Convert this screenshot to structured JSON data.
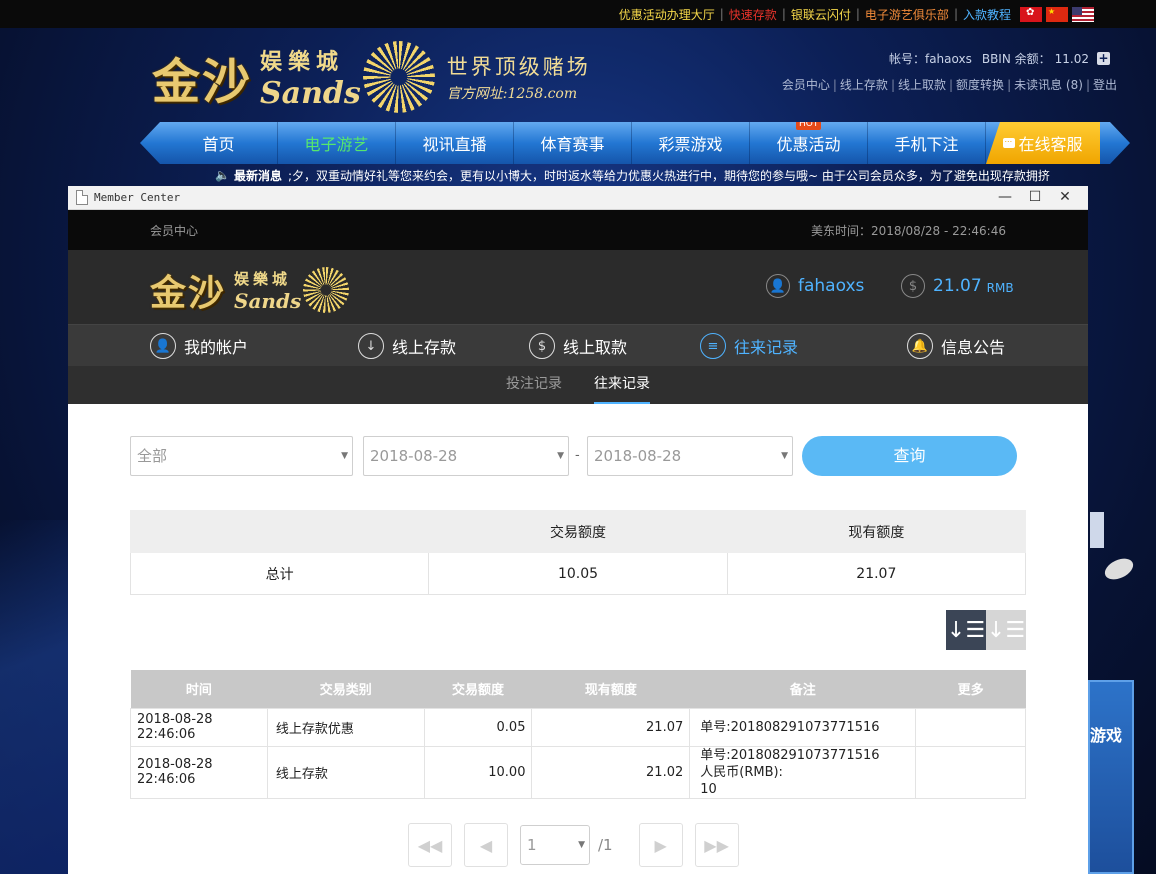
{
  "top_links": [
    {
      "label": "优惠活动办理大厅",
      "color": "#f5d84a"
    },
    {
      "label": "快速存款",
      "color": "#e8332a"
    },
    {
      "label": "银联云闪付",
      "color": "#f5d84a"
    },
    {
      "label": "电子游艺俱乐部",
      "color": "#f08a3a"
    },
    {
      "label": "入款教程",
      "color": "#4fb3ff"
    }
  ],
  "header": {
    "logo_main": "金沙",
    "logo_cn": "娱樂城",
    "logo_en": "Sands",
    "slogan": "世界顶级赌场",
    "site_url": "官方网址:1258.com",
    "account_label": "帐号：fahaoxs",
    "balance_label": "BBIN 余额：",
    "balance_value": "11.02",
    "plus": "+",
    "links": [
      "会员中心",
      "线上存款",
      "线上取款",
      "额度转换",
      "未读讯息 (8)",
      "登出"
    ]
  },
  "main_nav": {
    "items": [
      "首页",
      "电子游艺",
      "视讯直播",
      "体育赛事",
      "彩票游戏",
      "优惠活动",
      "手机下注"
    ],
    "active_index": 1,
    "hot_badge": "HOT",
    "service": "在线客服"
  },
  "marquee": {
    "label": "最新消息",
    "text": ";夕，双重动情好礼等您来约会，更有以小博大，时时返水等给力优惠火热进行中，期待您的参与哦~    由于公司会员众多，为了避免出现存款拥挤"
  },
  "deco": {
    "right_text": "游戏"
  },
  "window": {
    "title": "Member Center",
    "btn_min": "—",
    "btn_max": "☐",
    "btn_close": "✕"
  },
  "member_center": {
    "topbar_left": "会员中心",
    "topbar_right": "美东时间：2018/08/28 - 22:46:46",
    "username": "fahaoxs",
    "balance": "21.07",
    "currency": "RMB",
    "nav": [
      "我的帐户",
      "线上存款",
      "线上取款",
      "往来记录",
      "信息公告"
    ],
    "active_nav": 3,
    "subtabs": [
      "投注记录",
      "往来记录"
    ],
    "active_subtab": 1
  },
  "filters": {
    "type_value": "全部",
    "date_from": "2018-08-28",
    "date_sep": "-",
    "date_to": "2018-08-28",
    "query_label": "查询"
  },
  "summary": {
    "headers": [
      "",
      "交易额度",
      "现有额度"
    ],
    "row": [
      "总计",
      "10.05",
      "21.07"
    ]
  },
  "records": {
    "headers": [
      "时间",
      "交易类别",
      "交易额度",
      "现有额度",
      "备注",
      "更多"
    ],
    "rows": [
      {
        "time": "2018-08-28 22:46:06",
        "type": "线上存款优惠",
        "amount": "0.05",
        "balance": "21.07",
        "note": [
          "单号:201808291073771516"
        ],
        "more": ""
      },
      {
        "time": "2018-08-28 22:46:06",
        "type": "线上存款",
        "amount": "10.00",
        "balance": "21.02",
        "note": [
          "单号:201808291073771516",
          "人民币(RMB):",
          "10"
        ],
        "more": ""
      }
    ]
  },
  "pager": {
    "first": "◀◀",
    "prev": "◀",
    "current": "1",
    "total": "/1",
    "next": "▶",
    "last": "▶▶"
  }
}
